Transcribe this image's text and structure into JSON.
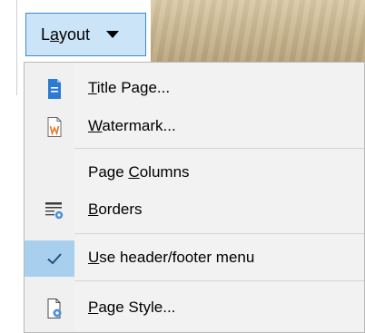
{
  "toolbar": {
    "layout_button": {
      "prefix": "L",
      "accel": "a",
      "suffix": "yout"
    }
  },
  "menu": {
    "items": [
      {
        "name": "title-page",
        "prefix": "",
        "accel": "T",
        "suffix": "itle Page...",
        "icon": "title-page-icon"
      },
      {
        "name": "watermark",
        "prefix": "",
        "accel": "W",
        "suffix": "atermark...",
        "icon": "watermark-icon"
      },
      {
        "name": "page-columns",
        "prefix": "Page ",
        "accel": "C",
        "suffix": "olumns",
        "icon": ""
      },
      {
        "name": "borders",
        "prefix": "",
        "accel": "B",
        "suffix": "orders",
        "icon": "borders-icon"
      },
      {
        "name": "use-header-footer-menu",
        "prefix": "",
        "accel": "U",
        "suffix": "se header/footer menu",
        "icon": "checkmark-icon",
        "checked": true
      },
      {
        "name": "page-style",
        "prefix": "",
        "accel": "P",
        "suffix": "age Style...",
        "icon": "page-style-icon"
      }
    ]
  },
  "colors": {
    "accent": "#3c8ad0",
    "check_highlight": "#a9cfee"
  }
}
